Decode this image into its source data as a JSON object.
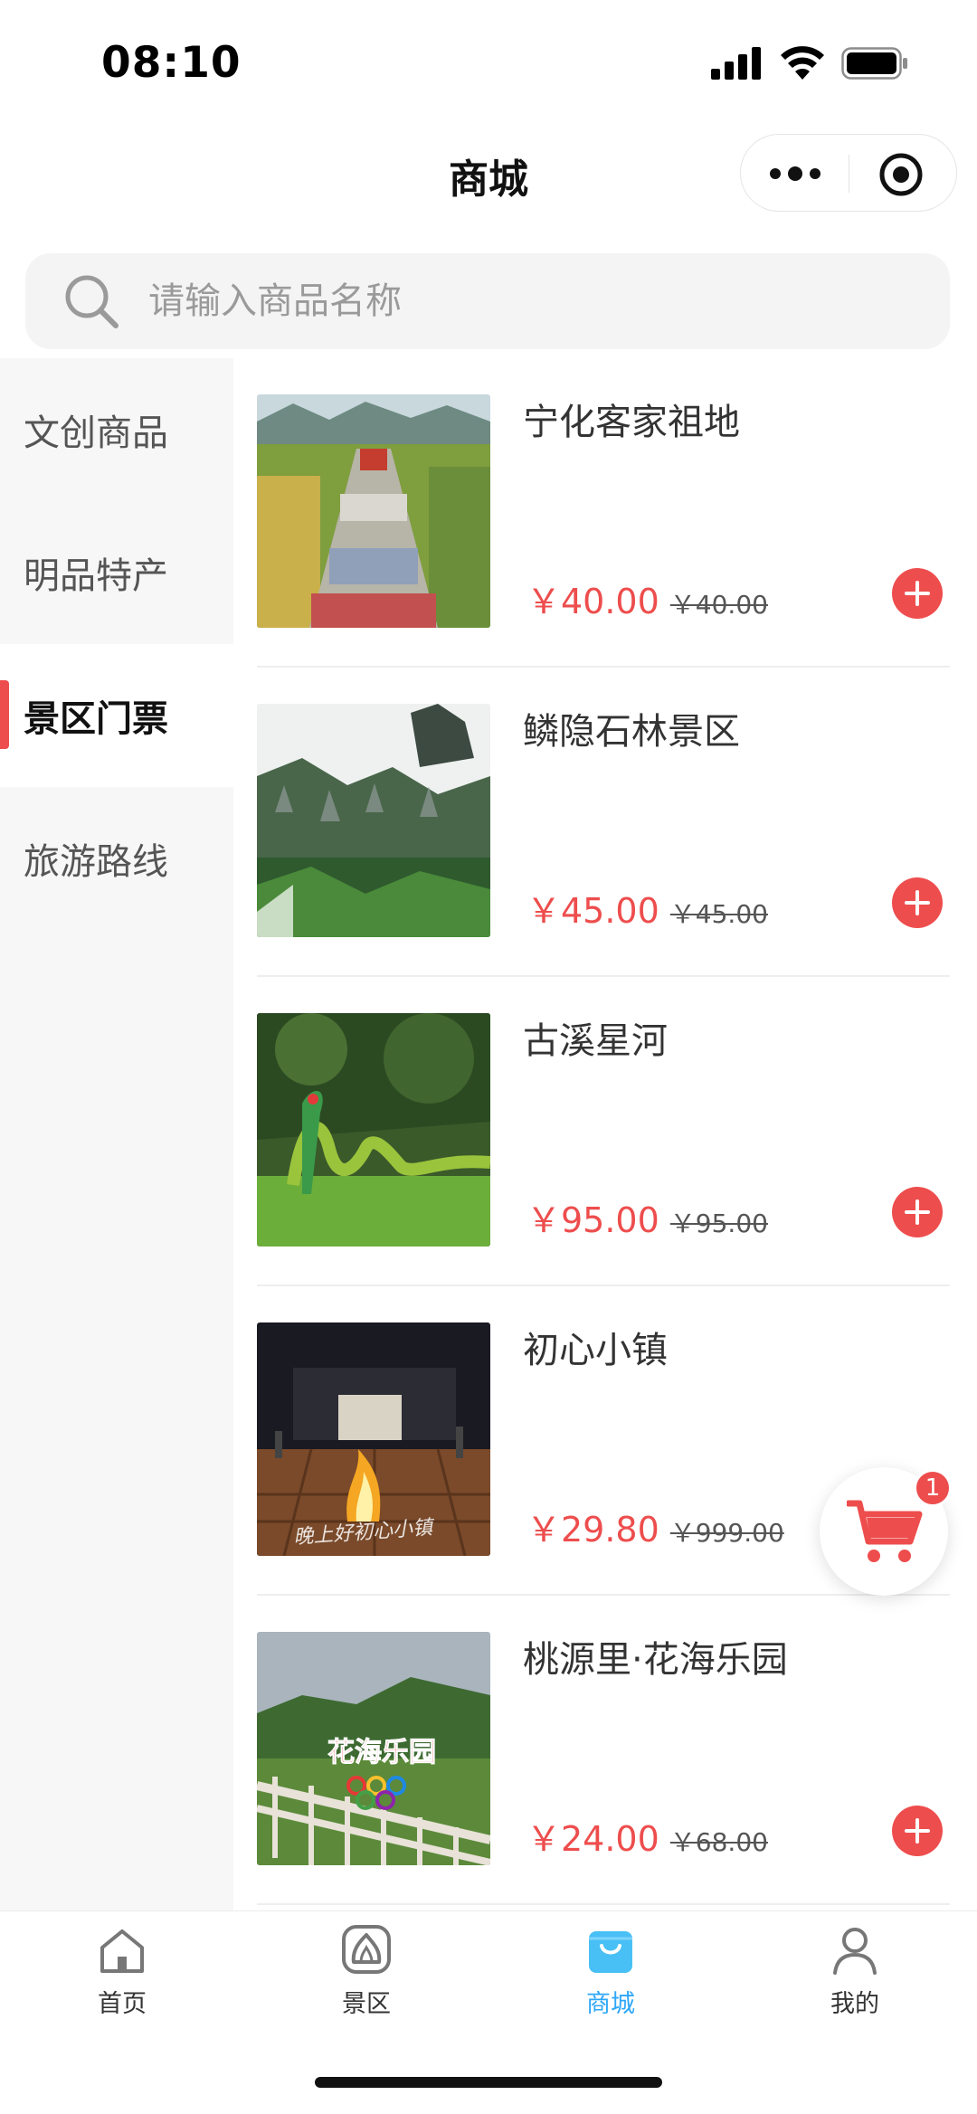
{
  "status_bar": {
    "time": "08:10"
  },
  "nav": {
    "title": "商城"
  },
  "search": {
    "placeholder": "请输入商品名称"
  },
  "categories": [
    {
      "label": "文创商品",
      "active": false
    },
    {
      "label": "明品特产",
      "active": false
    },
    {
      "label": "景区门票",
      "active": true
    },
    {
      "label": "旅游路线",
      "active": false
    }
  ],
  "products": [
    {
      "name": "宁化客家祖地",
      "price": "￥40.00",
      "original_price": "￥40.00"
    },
    {
      "name": "鳞隐石林景区",
      "price": "￥45.00",
      "original_price": "￥45.00"
    },
    {
      "name": "古溪星河",
      "price": "￥95.00",
      "original_price": "￥95.00"
    },
    {
      "name": "初心小镇",
      "price": "￥29.80",
      "original_price": "￥999.00",
      "image_caption": "晚上好初心小镇"
    },
    {
      "name": "桃源里·花海乐园",
      "price": "￥24.00",
      "original_price": "￥68.00",
      "image_sign": "花海乐园"
    }
  ],
  "cart": {
    "badge_count": "1",
    "icon": "shopping-cart-icon"
  },
  "tab_bar": [
    {
      "label": "首页",
      "icon": "home-icon",
      "active": false
    },
    {
      "label": "景区",
      "icon": "scenic-icon",
      "active": false
    },
    {
      "label": "商城",
      "icon": "shopping-bag-icon",
      "active": true
    },
    {
      "label": "我的",
      "icon": "user-icon",
      "active": false
    }
  ],
  "colors": {
    "accent_red": "#ee4d4d",
    "tab_active_blue": "#2ea7f7",
    "sidebar_bg": "#f7f7f7",
    "search_bg": "#f4f4f4"
  }
}
